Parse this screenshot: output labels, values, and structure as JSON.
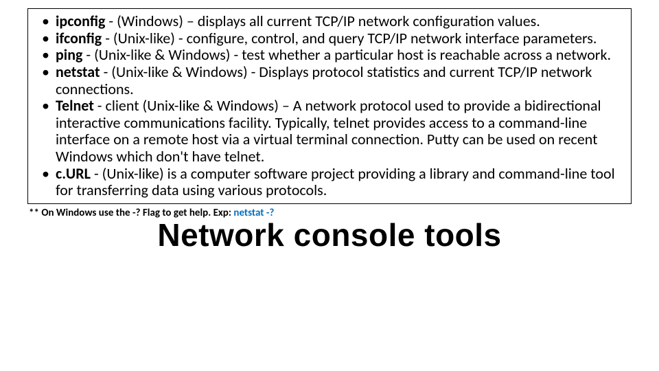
{
  "bullets": [
    {
      "term": "ipconfig",
      "rest": " - (Windows) – displays all current TCP/IP network configuration values."
    },
    {
      "term": "ifconfig",
      "rest": " - (Unix-like) - configure, control, and query TCP/IP network interface parameters."
    },
    {
      "term": "ping",
      "rest": " - (Unix-like & Windows) - test whether a particular host is reachable across a network."
    },
    {
      "term": "netstat",
      "rest": " - (Unix-like & Windows) - Displays protocol statistics and current TCP/IP network connections."
    },
    {
      "term": "Telnet",
      "rest": " - client (Unix-like & Windows) – A network protocol used to provide a bidirectional interactive communications facility. Typically, telnet provides access to a command-line interface on a remote host via a virtual terminal connection. Putty can be used on recent Windows which don't have telnet."
    },
    {
      "term": "c.URL",
      "rest": " - (Unix-like)  is a computer software project providing a library and command-line tool for transferring data using various protocols."
    }
  ],
  "footnote": {
    "prefix": "** On Windows use the -? Flag to get help. Exp: ",
    "command": "netstat -?"
  },
  "title": "Network console tools"
}
